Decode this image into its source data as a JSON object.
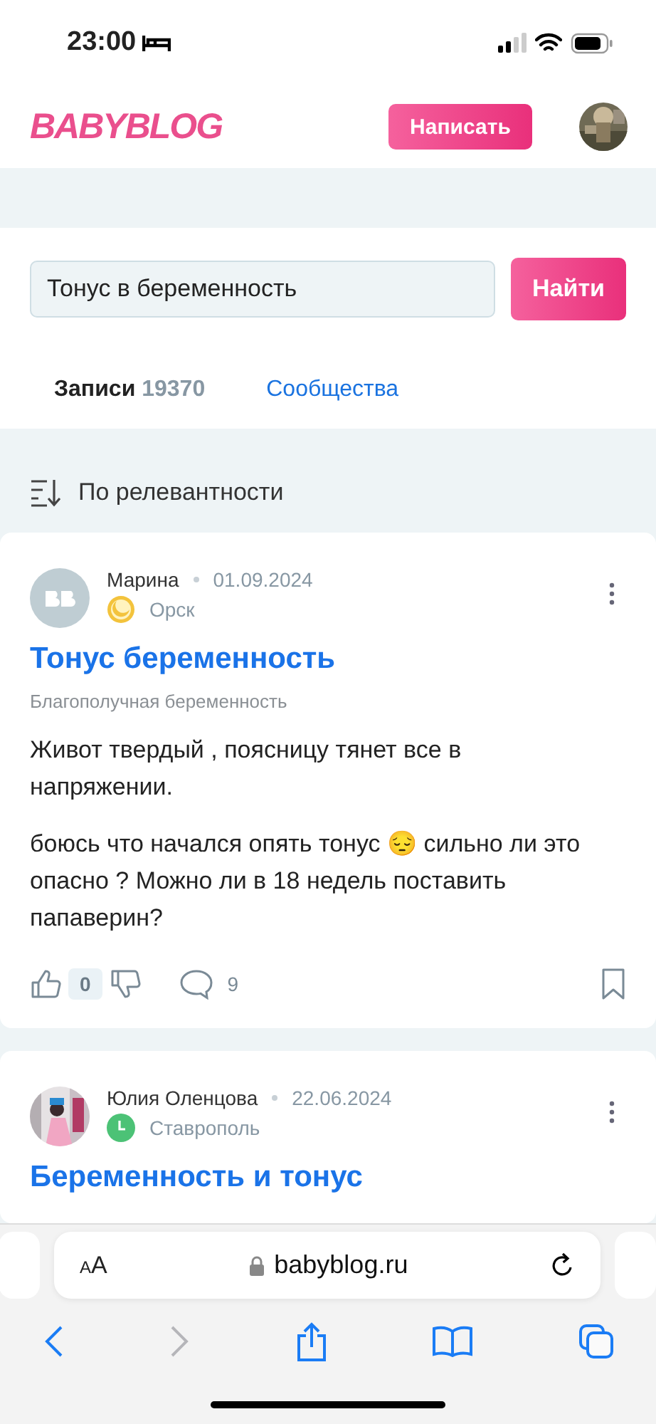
{
  "status_bar": {
    "time": "23:00"
  },
  "header": {
    "logo": "BABYBLOG",
    "write_button": "Написать"
  },
  "search": {
    "value": "Тонус в беременность",
    "button": "Найти"
  },
  "tabs": [
    {
      "label": "Записи",
      "count": "19370",
      "selected": true
    },
    {
      "label": "Сообщества",
      "selected": false
    }
  ],
  "sort": {
    "label": "По релевантности"
  },
  "posts": [
    {
      "author": "Марина",
      "date": "01.09.2024",
      "city": "Орск",
      "avatar": {
        "kind": "logo"
      },
      "badge": {
        "kind": "moon"
      },
      "title": "Тонус беременность",
      "community": "Благополучная беременность",
      "paragraphs": [
        "Живот твердый , поясницу тянет все в напряжении.",
        "боюсь что начался опять тонус 😔 сильно ли это опасно ? Можно ли в 18 недель поставить папаверин?"
      ],
      "likes": "0",
      "comments": "9"
    },
    {
      "author": "Юлия Оленцова",
      "date": "22.06.2024",
      "city": "Ставрополь",
      "badge": {
        "kind": "clock"
      },
      "title": "Беременность и тонус"
    }
  ],
  "browser": {
    "text_size": "AA",
    "url": "babyblog.ru"
  }
}
